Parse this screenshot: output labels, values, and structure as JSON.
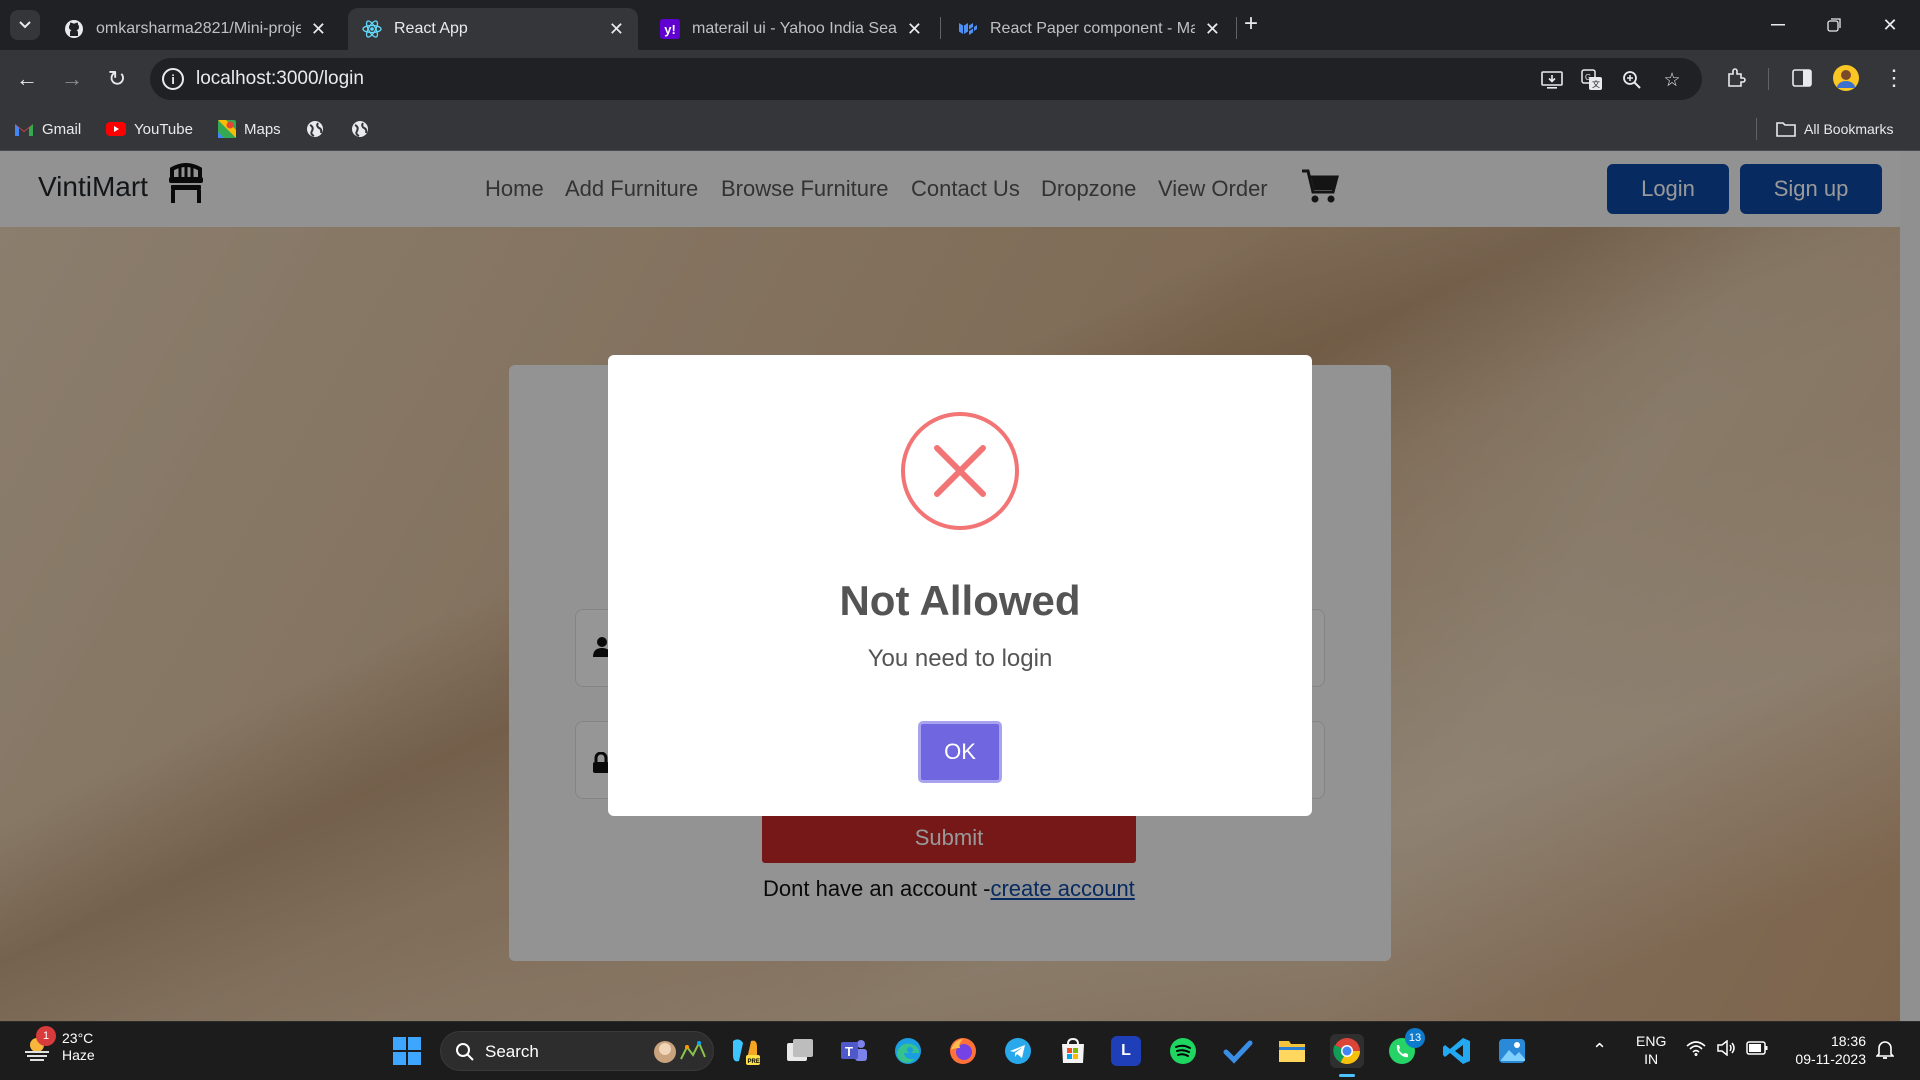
{
  "browser": {
    "tabs": [
      {
        "title": "omkarsharma2821/Mini-project",
        "icon": "github-icon",
        "active": false
      },
      {
        "title": "React App",
        "icon": "react-icon",
        "active": true
      },
      {
        "title": "materail ui - Yahoo India Search",
        "icon": "yahoo-icon",
        "active": false
      },
      {
        "title": "React Paper component - Mate",
        "icon": "mui-icon",
        "active": false
      }
    ],
    "url": "localhost:3000/login",
    "bookmarks": [
      {
        "label": "Gmail",
        "icon": "gmail-icon"
      },
      {
        "label": "YouTube",
        "icon": "youtube-icon"
      },
      {
        "label": "Maps",
        "icon": "maps-icon"
      }
    ],
    "all_bookmarks": "All Bookmarks"
  },
  "site": {
    "brand": "VintiMart",
    "nav": [
      "Home",
      "Add Furniture",
      "Browse Furniture",
      "Contact Us",
      "Dropzone",
      "View Order"
    ],
    "login_label": "Login",
    "signup_label": "Sign up"
  },
  "login_form": {
    "submit_label": "Submit",
    "no_account_text": "Dont have an account -",
    "create_account_link": "create account"
  },
  "modal": {
    "title": "Not Allowed",
    "text": "You need to login",
    "ok_label": "OK",
    "icon": "error-x-icon",
    "accent": "#f27474",
    "button_color": "#7066e0"
  },
  "taskbar": {
    "weather_badge": "1",
    "temperature": "23°C",
    "condition": "Haze",
    "search_label": "Search",
    "whatsapp_badge": "13",
    "lang_top": "ENG",
    "lang_bottom": "IN",
    "time": "18:36",
    "date": "09-11-2023"
  }
}
